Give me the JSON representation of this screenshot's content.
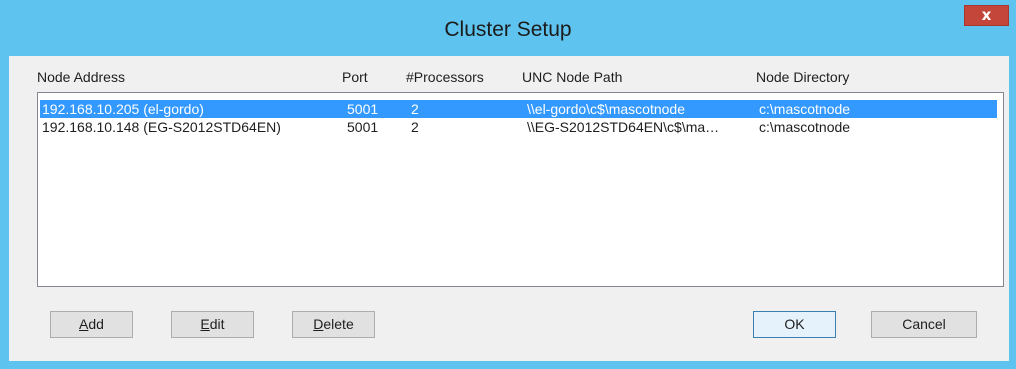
{
  "window": {
    "title": "Cluster Setup",
    "close_glyph": "x"
  },
  "list": {
    "columns": [
      "Node Address",
      "Port",
      "#Processors",
      "UNC Node Path",
      "Node Directory"
    ],
    "rows": [
      {
        "address": "192.168.10.205 (el-gordo)",
        "port": "5001",
        "processors": "2",
        "unc_path": "\\\\el-gordo\\c$\\mascotnode",
        "directory": "c:\\mascotnode",
        "selected": true
      },
      {
        "address": "192.168.10.148 (EG-S2012STD64EN)",
        "port": "5001",
        "processors": "2",
        "unc_path": "\\\\EG-S2012STD64EN\\c$\\ma…",
        "directory": "c:\\mascotnode",
        "selected": false
      }
    ]
  },
  "buttons": {
    "add": {
      "mnemonic": "A",
      "rest": "dd"
    },
    "edit": {
      "mnemonic": "E",
      "rest": "dit"
    },
    "delete": {
      "mnemonic": "D",
      "rest": "elete"
    },
    "ok": "OK",
    "cancel": "Cancel"
  },
  "colors": {
    "titlebar": "#5ec3ef",
    "close_button": "#c4463a",
    "selection": "#3399ff"
  }
}
